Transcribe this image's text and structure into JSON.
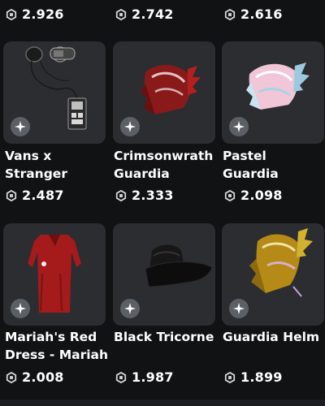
{
  "top_prices": [
    "2.926",
    "2.742",
    "2.616"
  ],
  "items": [
    {
      "name_lines": [
        "Vans x",
        "Stranger"
      ],
      "price": "2.487",
      "image": "headphones-walkman"
    },
    {
      "name_lines": [
        "Crimsonwrath",
        "Guardia"
      ],
      "price": "2.333",
      "image": "crimson-guardia-helm"
    },
    {
      "name_lines": [
        "Pastel",
        "Guardia"
      ],
      "price": "2.098",
      "image": "pastel-guardia-helm"
    },
    {
      "name_lines": [
        "Mariah's Red",
        "Dress - Mariah"
      ],
      "price": "2.008",
      "image": "red-dress"
    },
    {
      "name_lines": [
        "Black Tricorne",
        ""
      ],
      "price": "1.987",
      "image": "black-tricorne-hat"
    },
    {
      "name_lines": [
        "Guardia Helm",
        ""
      ],
      "price": "1.899",
      "image": "gold-guardia-helm"
    }
  ],
  "icons": {
    "currency": "robux-icon",
    "badge": "star-badge-icon"
  },
  "colors": {
    "background": "#111214",
    "card": "#2b2d31",
    "badge": "#5b5f66",
    "text": "#ffffff"
  }
}
